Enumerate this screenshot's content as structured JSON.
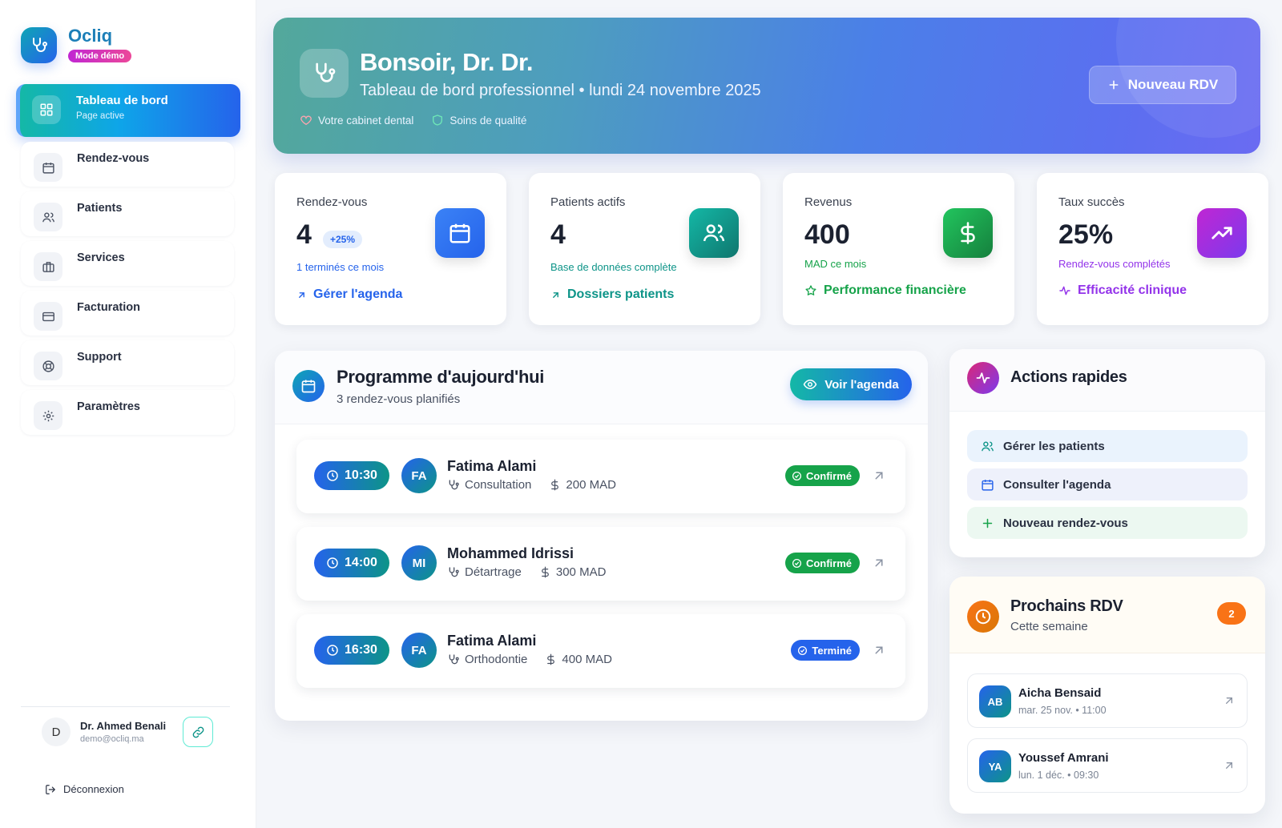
{
  "brand": {
    "name": "Ocliq",
    "badge": "Mode démo"
  },
  "sidebar": {
    "items": [
      {
        "label": "Tableau de bord",
        "sub": "Page active",
        "icon": "grid-icon",
        "active": true
      },
      {
        "label": "Rendez-vous",
        "icon": "calendar-icon"
      },
      {
        "label": "Patients",
        "icon": "users-icon"
      },
      {
        "label": "Services",
        "icon": "briefcase-icon"
      },
      {
        "label": "Facturation",
        "icon": "credit-card-icon"
      },
      {
        "label": "Support",
        "icon": "lifebuoy-icon"
      },
      {
        "label": "Paramètres",
        "icon": "gear-icon"
      }
    ],
    "user": {
      "initial": "D",
      "name": "Dr. Ahmed Benali",
      "email": "demo@ocliq.ma"
    },
    "logout": "Déconnexion"
  },
  "hero": {
    "title": "Bonsoir, Dr. Dr.",
    "subtitle": "Tableau de bord professionnel • lundi 24 novembre 2025",
    "tag1": "Votre cabinet dental",
    "tag2": "Soins de qualité",
    "button": "Nouveau RDV"
  },
  "stats": [
    {
      "label": "Rendez-vous",
      "value": "4",
      "badge": "+25%",
      "note": "1 terminés ce mois",
      "link": "Gérer l'agenda",
      "color": "#2563eb"
    },
    {
      "label": "Patients actifs",
      "value": "4",
      "note": "Base de données complète",
      "link": "Dossiers patients",
      "color": "#0d9488"
    },
    {
      "label": "Revenus",
      "value": "400",
      "note": "MAD ce mois",
      "link": "Performance financière",
      "color": "#16a34a"
    },
    {
      "label": "Taux succès",
      "value": "25%",
      "note": "Rendez-vous complétés",
      "link": "Efficacité clinique",
      "color": "#9333ea"
    }
  ],
  "programme": {
    "title": "Programme d'aujourd'hui",
    "subtitle": "3 rendez-vous planifiés",
    "button": "Voir l'agenda",
    "appointments": [
      {
        "time": "10:30",
        "initials": "FA",
        "name": "Fatima Alami",
        "service": "Consultation",
        "price": "200 MAD",
        "status": "Confirmé",
        "status_color": "#16a34a"
      },
      {
        "time": "14:00",
        "initials": "MI",
        "name": "Mohammed Idrissi",
        "service": "Détartrage",
        "price": "300 MAD",
        "status": "Confirmé",
        "status_color": "#16a34a"
      },
      {
        "time": "16:30",
        "initials": "FA",
        "name": "Fatima Alami",
        "service": "Orthodontie",
        "price": "400 MAD",
        "status": "Terminé",
        "status_color": "#2563eb"
      }
    ]
  },
  "quick": {
    "title": "Actions rapides",
    "actions": [
      {
        "label": "Gérer les patients",
        "icon": "users-icon"
      },
      {
        "label": "Consulter l'agenda",
        "icon": "calendar-icon"
      },
      {
        "label": "Nouveau rendez-vous",
        "icon": "plus-icon"
      }
    ]
  },
  "next": {
    "title": "Prochains RDV",
    "subtitle": "Cette semaine",
    "count": "2",
    "items": [
      {
        "initials": "AB",
        "name": "Aicha Bensaid",
        "date": "mar. 25 nov. • 11:00"
      },
      {
        "initials": "YA",
        "name": "Youssef Amrani",
        "date": "lun. 1 déc. • 09:30"
      }
    ]
  }
}
